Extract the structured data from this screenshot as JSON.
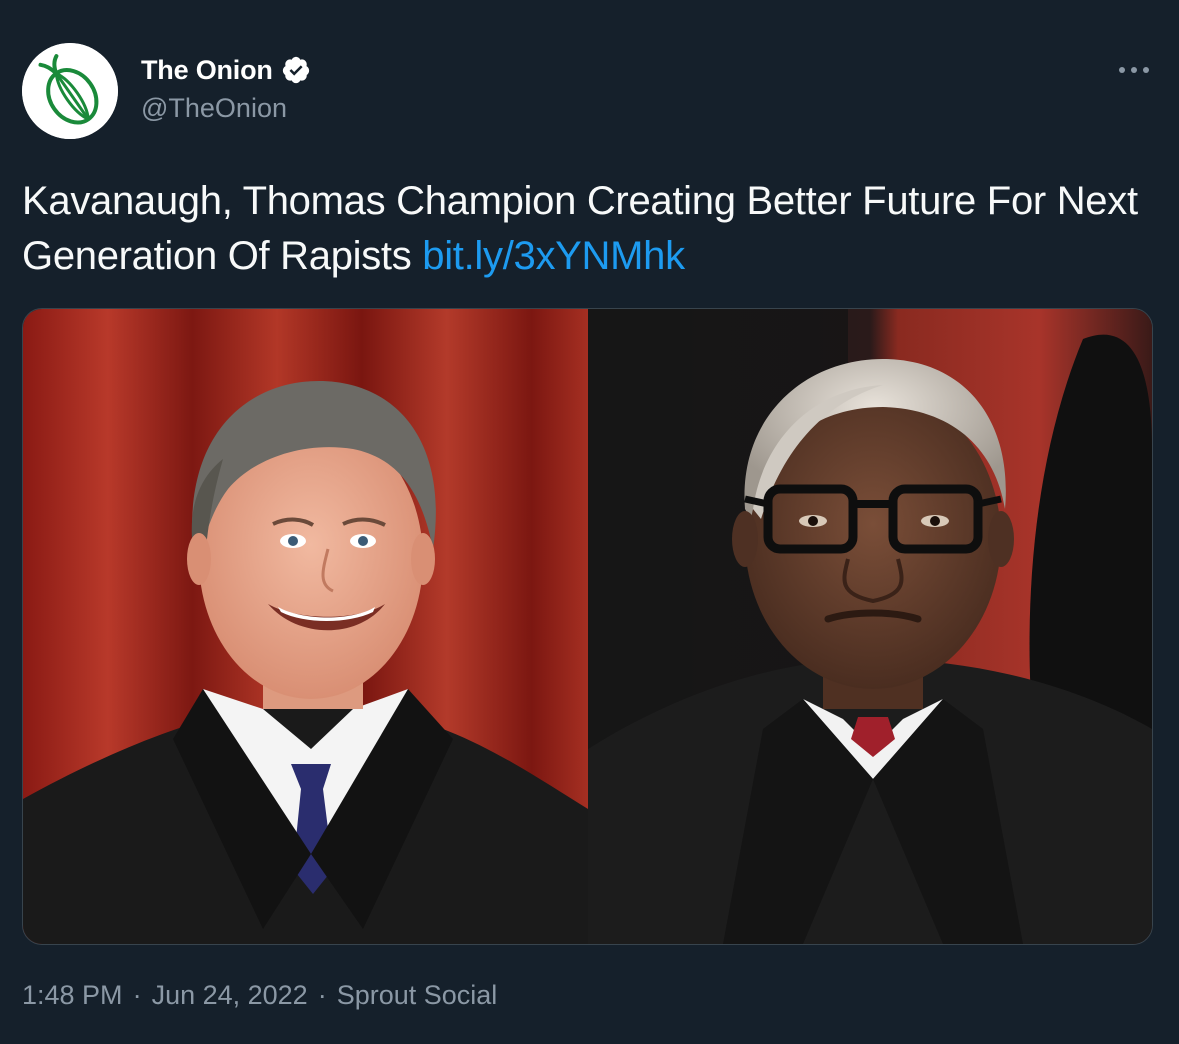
{
  "tweet": {
    "author": {
      "display_name": "The Onion",
      "handle": "@TheOnion",
      "verified": true,
      "avatar_icon": "onion-logo-icon",
      "brand_color": "#1a8a3a"
    },
    "more_icon": "more-options-icon",
    "text": "Kavanaugh, Thomas Champion Creating Better Future For Next Generation Of Rapists",
    "link": "bit.ly/3xYNMhk",
    "link_color": "#1d9bf0",
    "media": {
      "kind": "photo",
      "panels": 2
    },
    "meta": {
      "time": "1:48 PM",
      "separator": "·",
      "date": "Jun 24, 2022",
      "source": "Sprout Social"
    }
  },
  "colors": {
    "background": "#15202b",
    "secondary_text": "#8b98a5",
    "border": "#38444d"
  }
}
